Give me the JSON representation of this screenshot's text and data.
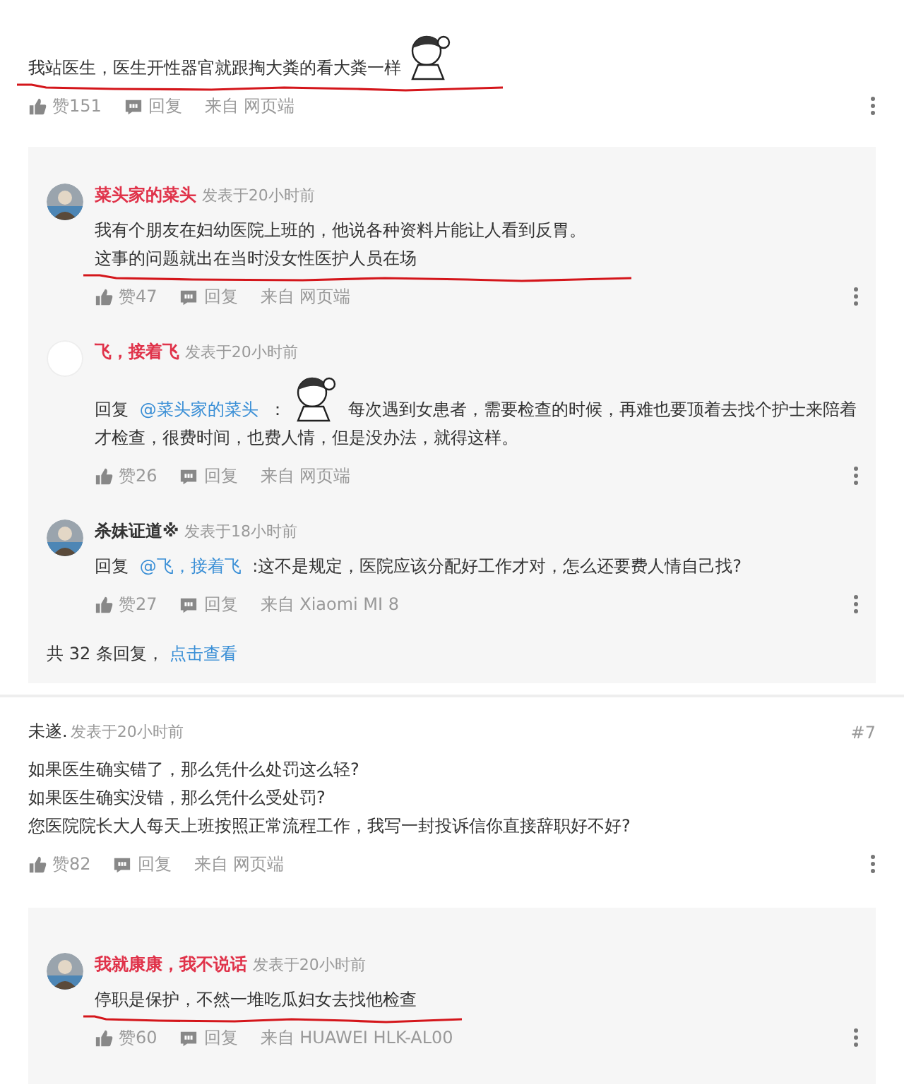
{
  "top_comment": {
    "body": [
      {
        "kind": "text",
        "text": "我站医生，医生开性器官就跟掏大粪的看大粪一样"
      },
      {
        "kind": "sticker"
      }
    ],
    "underlined": true,
    "likes": "赞151",
    "reply": "回复",
    "source": "来自 网页端"
  },
  "reply_box": {
    "replies": [
      {
        "name": "菜头家的菜头",
        "color": "#e0334a",
        "avatar": {
          "kind": "picture"
        },
        "meta": "发表于20小时前",
        "body": [
          {
            "kind": "text",
            "text": "我有个朋友在妇幼医院上班的，他说各种资料片能让人看到反胃。"
          },
          {
            "kind": "break"
          },
          {
            "kind": "text",
            "text": "这事的问题就出在当时没女性医护人员在场"
          }
        ],
        "underlined": true,
        "likes": "赞47",
        "reply": "回复",
        "source": "来自 网页端"
      },
      {
        "name": "飞，接着飞",
        "color": "#e0334a",
        "avatar": {
          "kind": "blank"
        },
        "meta": "发表于20小时前",
        "body": [
          {
            "kind": "text",
            "text": "回复 "
          },
          {
            "kind": "mention",
            "text": "@菜头家的菜头"
          },
          {
            "kind": "text",
            "text": " ："
          },
          {
            "kind": "sticker"
          },
          {
            "kind": "text",
            "text": " 每次遇到女患者，需要检查的时候，再难也要顶着去找个护士来陪着才检查，很费时间，也费人情，但是没办法，就得这样。"
          }
        ],
        "underlined": false,
        "likes": "赞26",
        "reply": "回复",
        "source": "来自 网页端"
      },
      {
        "name": "杀妹证道※",
        "color": "#333333",
        "avatar": {
          "kind": "picture"
        },
        "meta": "发表于18小时前",
        "body": [
          {
            "kind": "text",
            "text": "回复 "
          },
          {
            "kind": "mention",
            "text": "@飞，接着飞"
          },
          {
            "kind": "text",
            "text": " :这不是规定，医院应该分配好工作才对，怎么还要费人情自己找?"
          }
        ],
        "underlined": false,
        "likes": "赞27",
        "reply": "回复",
        "source": "来自 Xiaomi  MI  8"
      }
    ],
    "footer": {
      "count": "共  32  条回复，",
      "link": "点击查看"
    }
  },
  "comment": {
    "name": "未遂.",
    "meta": "发表于20小时前",
    "floor": "#7",
    "body": [
      {
        "kind": "text",
        "text": "如果医生确实错了，那么凭什么处罚这么轻?"
      },
      {
        "kind": "break"
      },
      {
        "kind": "text",
        "text": "如果医生确实没错，那么凭什么受处罚?"
      },
      {
        "kind": "break"
      },
      {
        "kind": "text",
        "text": "您医院院长大人每天上班按照正常流程工作，我写一封投诉信你直接辞职好不好?"
      }
    ],
    "underlined": false,
    "likes": "赞82",
    "reply": "回复",
    "source": "来自 网页端"
  },
  "reply_box_2": {
    "replies": [
      {
        "name": "我就康康，我不说话",
        "color": "#e0334a",
        "avatar": {
          "kind": "picture"
        },
        "meta": "发表于20小时前",
        "body": [
          {
            "kind": "text",
            "text": "停职是保护，不然一堆吃瓜妇女去找他检查"
          }
        ],
        "underlined": true,
        "likes": "赞60",
        "reply": "回复",
        "source": "来自 HUAWEI  HLK-AL00"
      }
    ]
  }
}
